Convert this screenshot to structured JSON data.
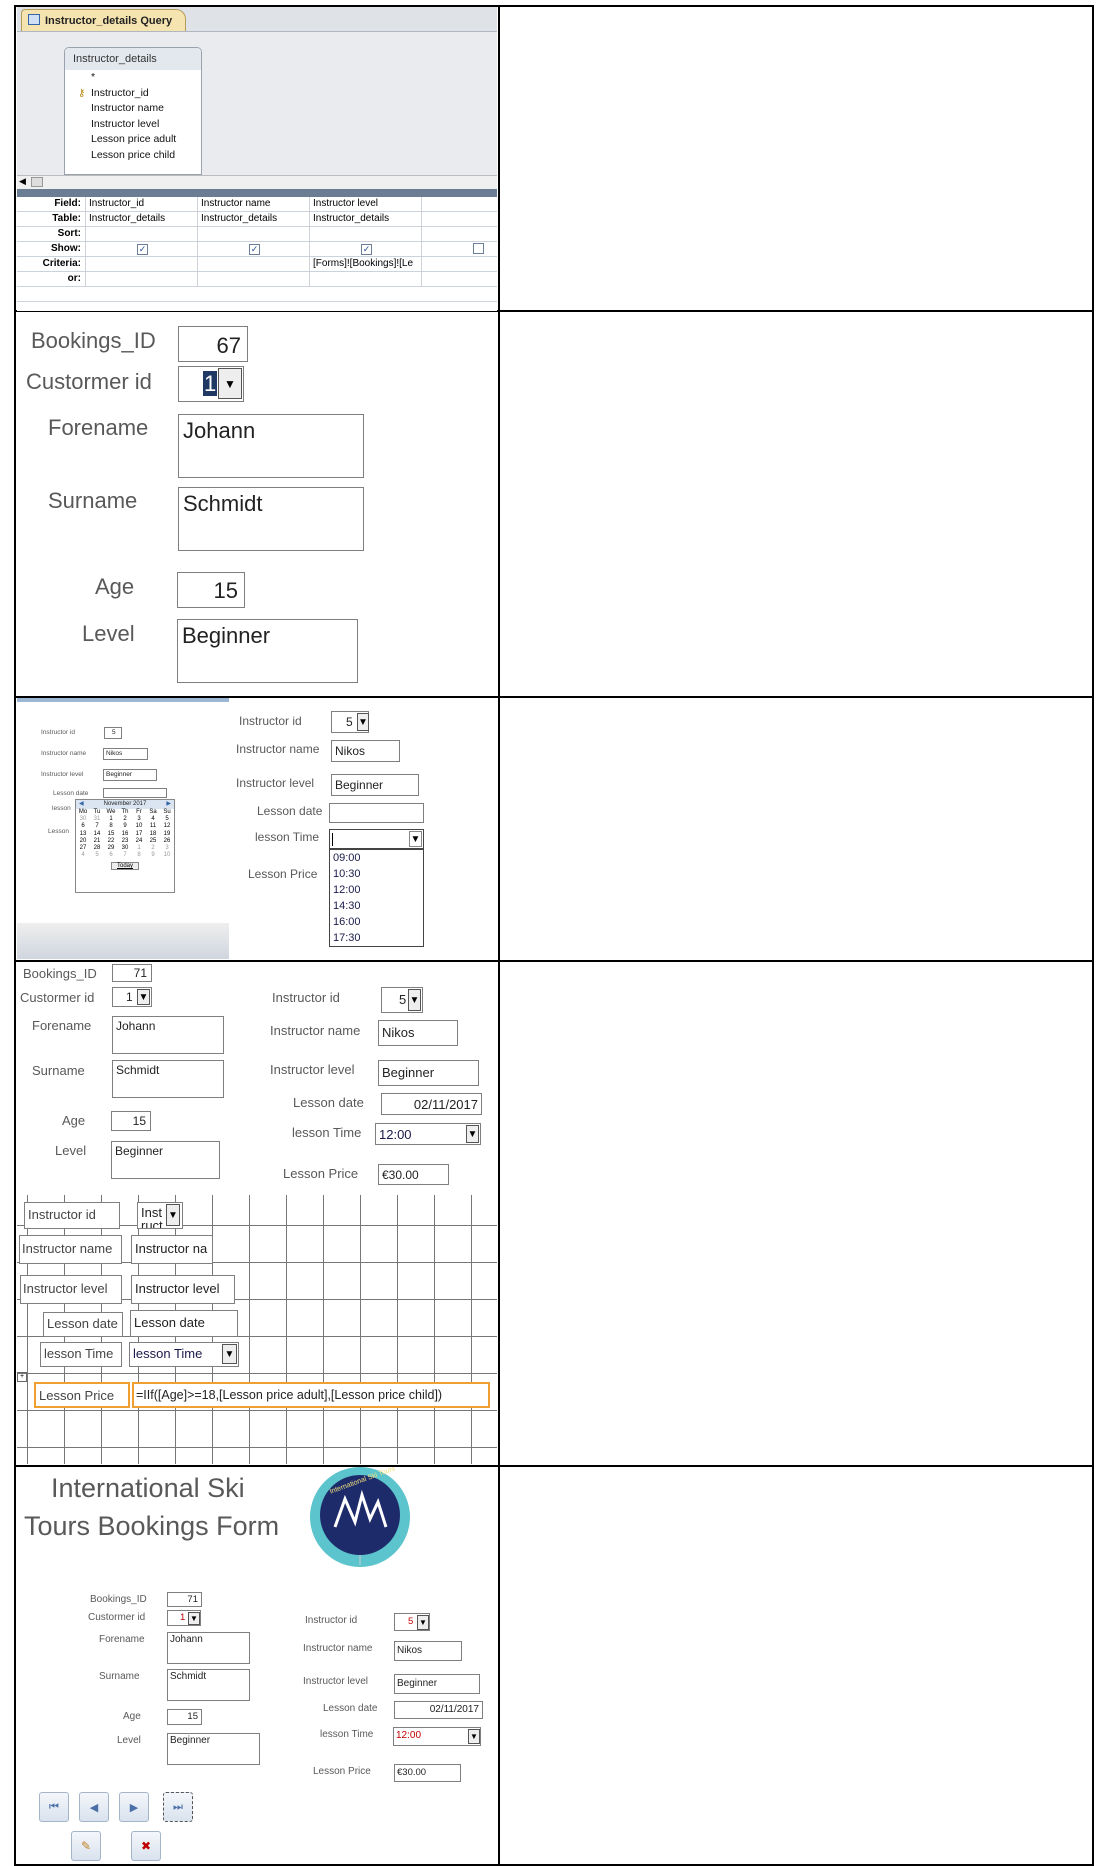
{
  "query_designer": {
    "tab_title": "Instructor_details Query",
    "table_name": "Instructor_details",
    "table_fields": [
      "*",
      "Instructor_id",
      "Instructor name",
      "Instructor level",
      "Lesson price adult",
      "Lesson price child"
    ],
    "row_headers": [
      "Field:",
      "Table:",
      "Sort:",
      "Show:",
      "Criteria:",
      "or:"
    ],
    "columns": [
      {
        "field": "Instructor_id",
        "table": "Instructor_details",
        "show": true,
        "criteria": ""
      },
      {
        "field": "Instructor name",
        "table": "Instructor_details",
        "show": true,
        "criteria": ""
      },
      {
        "field": "Instructor level",
        "table": "Instructor_details",
        "show": true,
        "criteria": "[Forms]![Bookings]![Le"
      },
      {
        "field": "",
        "table": "",
        "show": false,
        "criteria": ""
      }
    ]
  },
  "form_large": {
    "bookings_id_label": "Bookings_ID",
    "bookings_id": "67",
    "customer_id_label": "Custormer id",
    "customer_id": "1",
    "forename_label": "Forename",
    "forename": "Johann",
    "surname_label": "Surname",
    "surname": "Schmidt",
    "age_label": "Age",
    "age": "15",
    "level_label": "Level",
    "level": "Beginner"
  },
  "form_lesson": {
    "mini": {
      "instructor_id_label": "Instructor id",
      "instructor_id": "5",
      "instructor_name_label": "Instructor name",
      "instructor_name": "Nikos",
      "instructor_level_label": "Instructor level",
      "instructor_level": "Beginner",
      "lesson_date_label": "Lesson date",
      "lesson_time_label": "lesson",
      "lesson_price_label": "Lesson",
      "calendar_month": "November 2017",
      "calendar_days": [
        "Mo",
        "Tu",
        "We",
        "Th",
        "Fr",
        "Sa",
        "Su"
      ],
      "calendar_weeks": [
        [
          "30",
          "31",
          "1",
          "2",
          "3",
          "4",
          "5"
        ],
        [
          "6",
          "7",
          "8",
          "9",
          "10",
          "11",
          "12"
        ],
        [
          "13",
          "14",
          "15",
          "16",
          "17",
          "18",
          "19"
        ],
        [
          "20",
          "21",
          "22",
          "23",
          "24",
          "25",
          "26"
        ],
        [
          "27",
          "28",
          "29",
          "30",
          "1",
          "2",
          "3"
        ],
        [
          "4",
          "5",
          "6",
          "7",
          "8",
          "9",
          "10"
        ]
      ],
      "today_label": "Today"
    },
    "instructor_id_label": "Instructor id",
    "instructor_id": "5",
    "instructor_name_label": "Instructor name",
    "instructor_name": "Nikos",
    "instructor_level_label": "Instructor level",
    "instructor_level": "Beginner",
    "lesson_date_label": "Lesson date",
    "lesson_time_label": "lesson Time",
    "lesson_price_label": "Lesson Price",
    "time_options": [
      "09:00",
      "10:30",
      "12:00",
      "14:30",
      "16:00",
      "17:30"
    ]
  },
  "form_filled": {
    "bookings_id_label": "Bookings_ID",
    "bookings_id": "71",
    "customer_id_label": "Custormer id",
    "customer_id": "1",
    "forename_label": "Forename",
    "forename": "Johann",
    "surname_label": "Surname",
    "surname": "Schmidt",
    "age_label": "Age",
    "age": "15",
    "level_label": "Level",
    "level": "Beginner",
    "instructor_id_label": "Instructor id",
    "instructor_id": "5",
    "instructor_name_label": "Instructor name",
    "instructor_name": "Nikos",
    "instructor_level_label": "Instructor level",
    "instructor_level": "Beginner",
    "lesson_date_label": "Lesson date",
    "lesson_date": "02/11/2017",
    "lesson_time_label": "lesson Time",
    "lesson_time": "12:00",
    "lesson_price_label": "Lesson Price",
    "lesson_price": "€30.00"
  },
  "design_view": {
    "instructor_id_label": "Instructor id",
    "instructor_id_ctrl": "Inst ruct",
    "instructor_name_label": "Instructor name",
    "instructor_name_ctrl": "Instructor na",
    "instructor_level_label": "Instructor level",
    "instructor_level_ctrl": "Instructor level",
    "lesson_date_label": "Lesson date",
    "lesson_date_ctrl": "Lesson date",
    "lesson_time_label": "lesson Time",
    "lesson_time_ctrl": "lesson Time",
    "lesson_price_label": "Lesson Price",
    "lesson_price_expr": "=IIf([Age]>=18,[Lesson price adult],[Lesson price child])"
  },
  "final_form": {
    "title_line1": "International Ski",
    "title_line2": "Tours Bookings Form",
    "logo_text": "International Ski Tours",
    "bookings_id_label": "Bookings_ID",
    "bookings_id": "71",
    "customer_id_label": "Custormer id",
    "customer_id": "1",
    "forename_label": "Forename",
    "forename": "Johann",
    "surname_label": "Surname",
    "surname": "Schmidt",
    "age_label": "Age",
    "age": "15",
    "level_label": "Level",
    "level": "Beginner",
    "instructor_id_label": "Instructor id",
    "instructor_id": "5",
    "instructor_name_label": "Instructor name",
    "instructor_name": "Nikos",
    "instructor_level_label": "Instructor level",
    "instructor_level": "Beginner",
    "lesson_date_label": "Lesson date",
    "lesson_date": "02/11/2017",
    "lesson_time_label": "lesson Time",
    "lesson_time": "12:00",
    "lesson_price_label": "Lesson Price",
    "lesson_price": "€30.00",
    "accent_color": "#c00000"
  }
}
